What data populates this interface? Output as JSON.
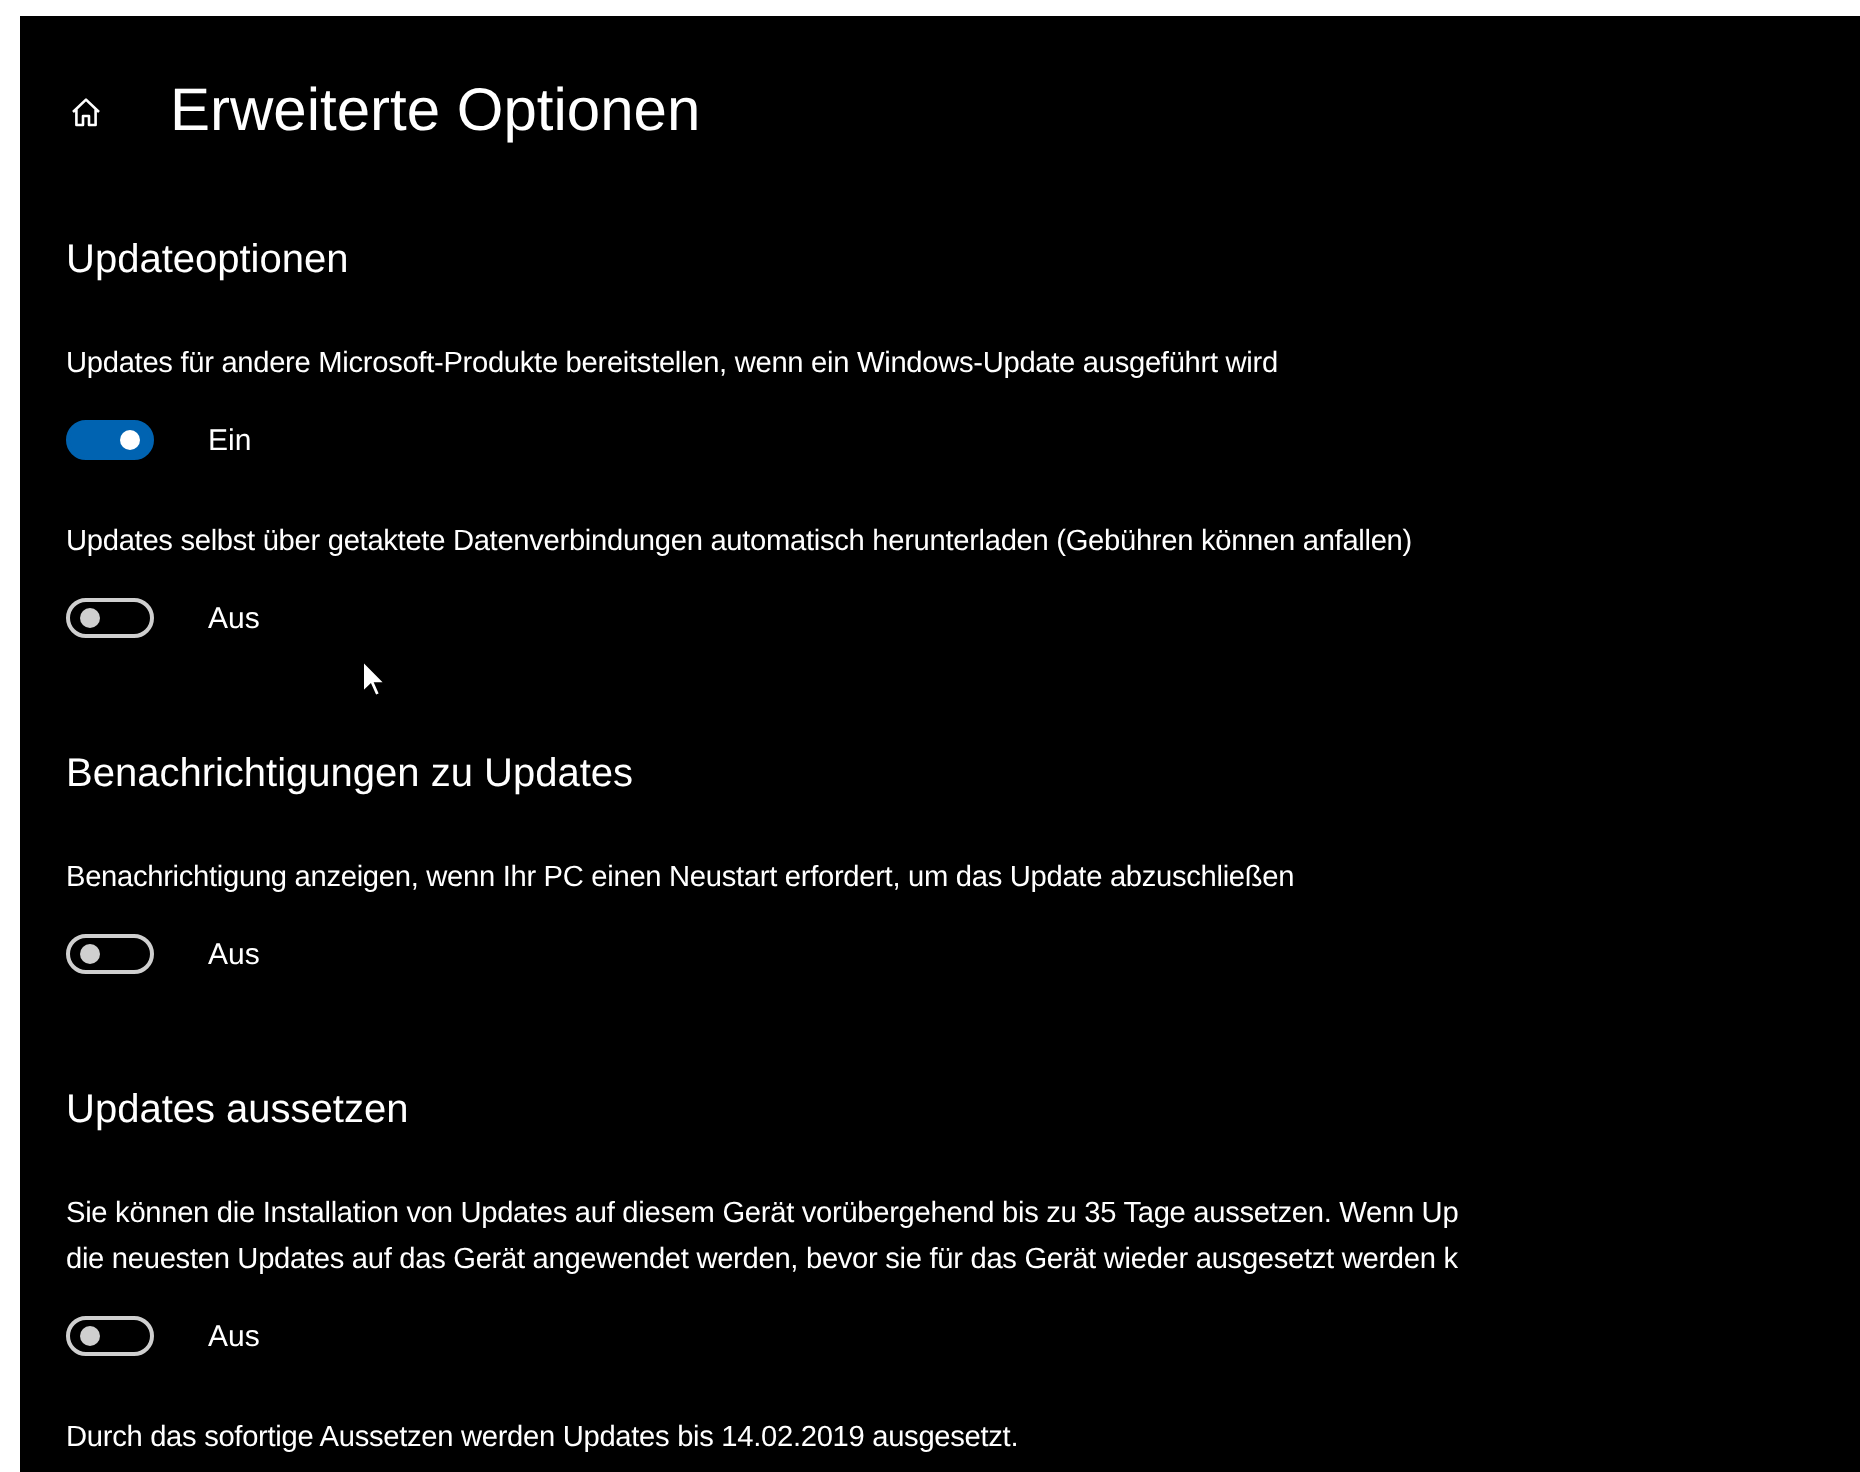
{
  "title": "Erweiterte Optionen",
  "sections": [
    {
      "heading": "Updateoptionen",
      "items": [
        {
          "kind": "text",
          "lines": [
            "Updates für andere Microsoft-Produkte bereitstellen, wenn ein Windows-Update ausgeführt wird"
          ]
        },
        {
          "kind": "toggle",
          "on": true,
          "state": "Ein"
        },
        {
          "kind": "text",
          "lines": [
            "Updates selbst über getaktete Datenverbindungen automatisch herunterladen (Gebühren können anfallen)"
          ]
        },
        {
          "kind": "toggle",
          "on": false,
          "state": "Aus"
        }
      ]
    },
    {
      "heading": "Benachrichtigungen zu Updates",
      "items": [
        {
          "kind": "text",
          "lines": [
            "Benachrichtigung anzeigen, wenn Ihr PC einen Neustart erfordert, um das Update abzuschließen"
          ]
        },
        {
          "kind": "toggle",
          "on": false,
          "state": "Aus"
        }
      ]
    },
    {
      "heading": "Updates aussetzen",
      "items": [
        {
          "kind": "text",
          "lines": [
            "Sie können die Installation von Updates auf diesem Gerät vorübergehend bis zu 35 Tage aussetzen. Wenn Up",
            "die neuesten Updates auf das Gerät angewendet werden, bevor sie für das Gerät wieder ausgesetzt werden k"
          ]
        },
        {
          "kind": "toggle",
          "on": false,
          "state": "Aus"
        },
        {
          "kind": "text",
          "lines": [
            "Durch das sofortige Aussetzen werden Updates bis 14.02.2019 ausgesetzt."
          ]
        }
      ]
    }
  ]
}
